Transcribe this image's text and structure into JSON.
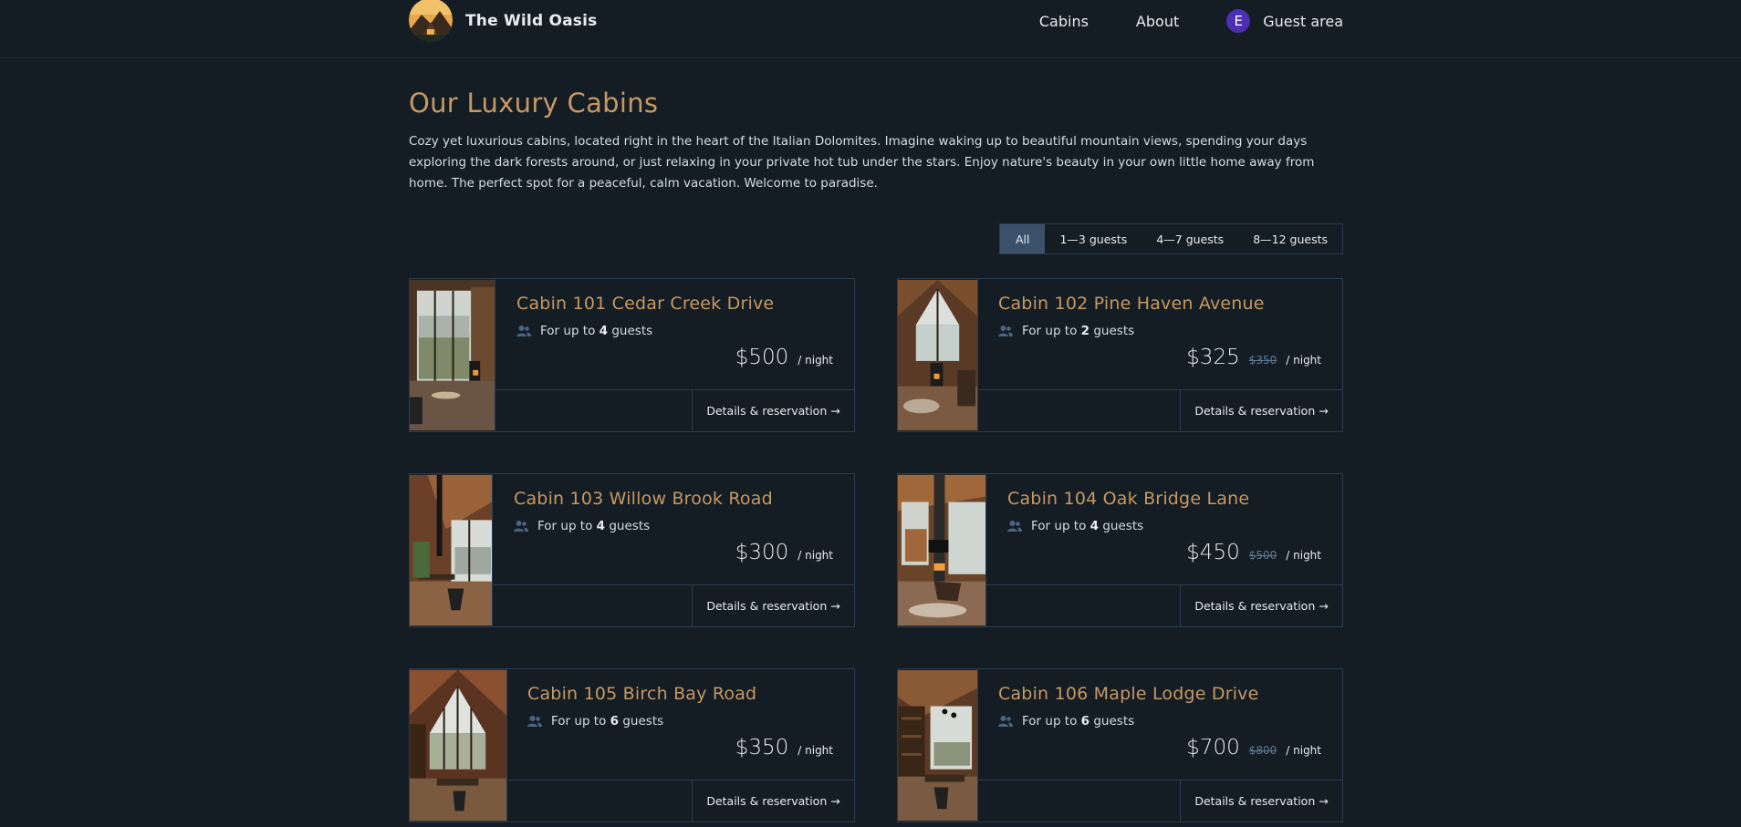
{
  "header": {
    "brand": "The Wild Oasis",
    "nav": {
      "cabins": "Cabins",
      "about": "About",
      "guest_area": "Guest area",
      "avatar_letter": "E"
    }
  },
  "main": {
    "title": "Our Luxury Cabins",
    "intro": "Cozy yet luxurious cabins, located right in the heart of the Italian Dolomites. Imagine waking up to beautiful mountain views, spending your days exploring the dark forests around, or just relaxing in your private hot tub under the stars. Enjoy nature's beauty in your own little home away from home. The perfect spot for a peaceful, calm vacation. Welcome to paradise.",
    "filters": [
      "All",
      "1—3 guests",
      "4—7 guests",
      "8—12 guests"
    ],
    "cards": [
      {
        "name": "Cabin 101 Cedar Creek Drive",
        "guests_prefix": "For up to",
        "guests": "4",
        "guests_suffix": "guests",
        "price": "$500",
        "old_price": "",
        "per_night": "/ night",
        "details": "Details & reservation →"
      },
      {
        "name": "Cabin 102 Pine Haven Avenue",
        "guests_prefix": "For up to",
        "guests": "2",
        "guests_suffix": "guests",
        "price": "$325",
        "old_price": "$350",
        "per_night": "/ night",
        "details": "Details & reservation →"
      },
      {
        "name": "Cabin 103 Willow Brook Road",
        "guests_prefix": "For up to",
        "guests": "4",
        "guests_suffix": "guests",
        "price": "$300",
        "old_price": "",
        "per_night": "/ night",
        "details": "Details & reservation →"
      },
      {
        "name": "Cabin 104 Oak Bridge Lane",
        "guests_prefix": "For up to",
        "guests": "4",
        "guests_suffix": "guests",
        "price": "$450",
        "old_price": "$500",
        "per_night": "/ night",
        "details": "Details & reservation →"
      },
      {
        "name": "Cabin 105 Birch Bay Road",
        "guests_prefix": "For up to",
        "guests": "6",
        "guests_suffix": "guests",
        "price": "$350",
        "old_price": "",
        "per_night": "/ night",
        "details": "Details & reservation →"
      },
      {
        "name": "Cabin 106 Maple Lodge Drive",
        "guests_prefix": "For up to",
        "guests": "6",
        "guests_suffix": "guests",
        "price": "$700",
        "old_price": "$800",
        "per_night": "/ night",
        "details": "Details & reservation →"
      }
    ]
  },
  "colors": {
    "background": "#141c24",
    "accent": "#c69963",
    "border": "#2c3d4f",
    "filter_active": "#3b5069",
    "avatar": "#4c2fb3"
  }
}
